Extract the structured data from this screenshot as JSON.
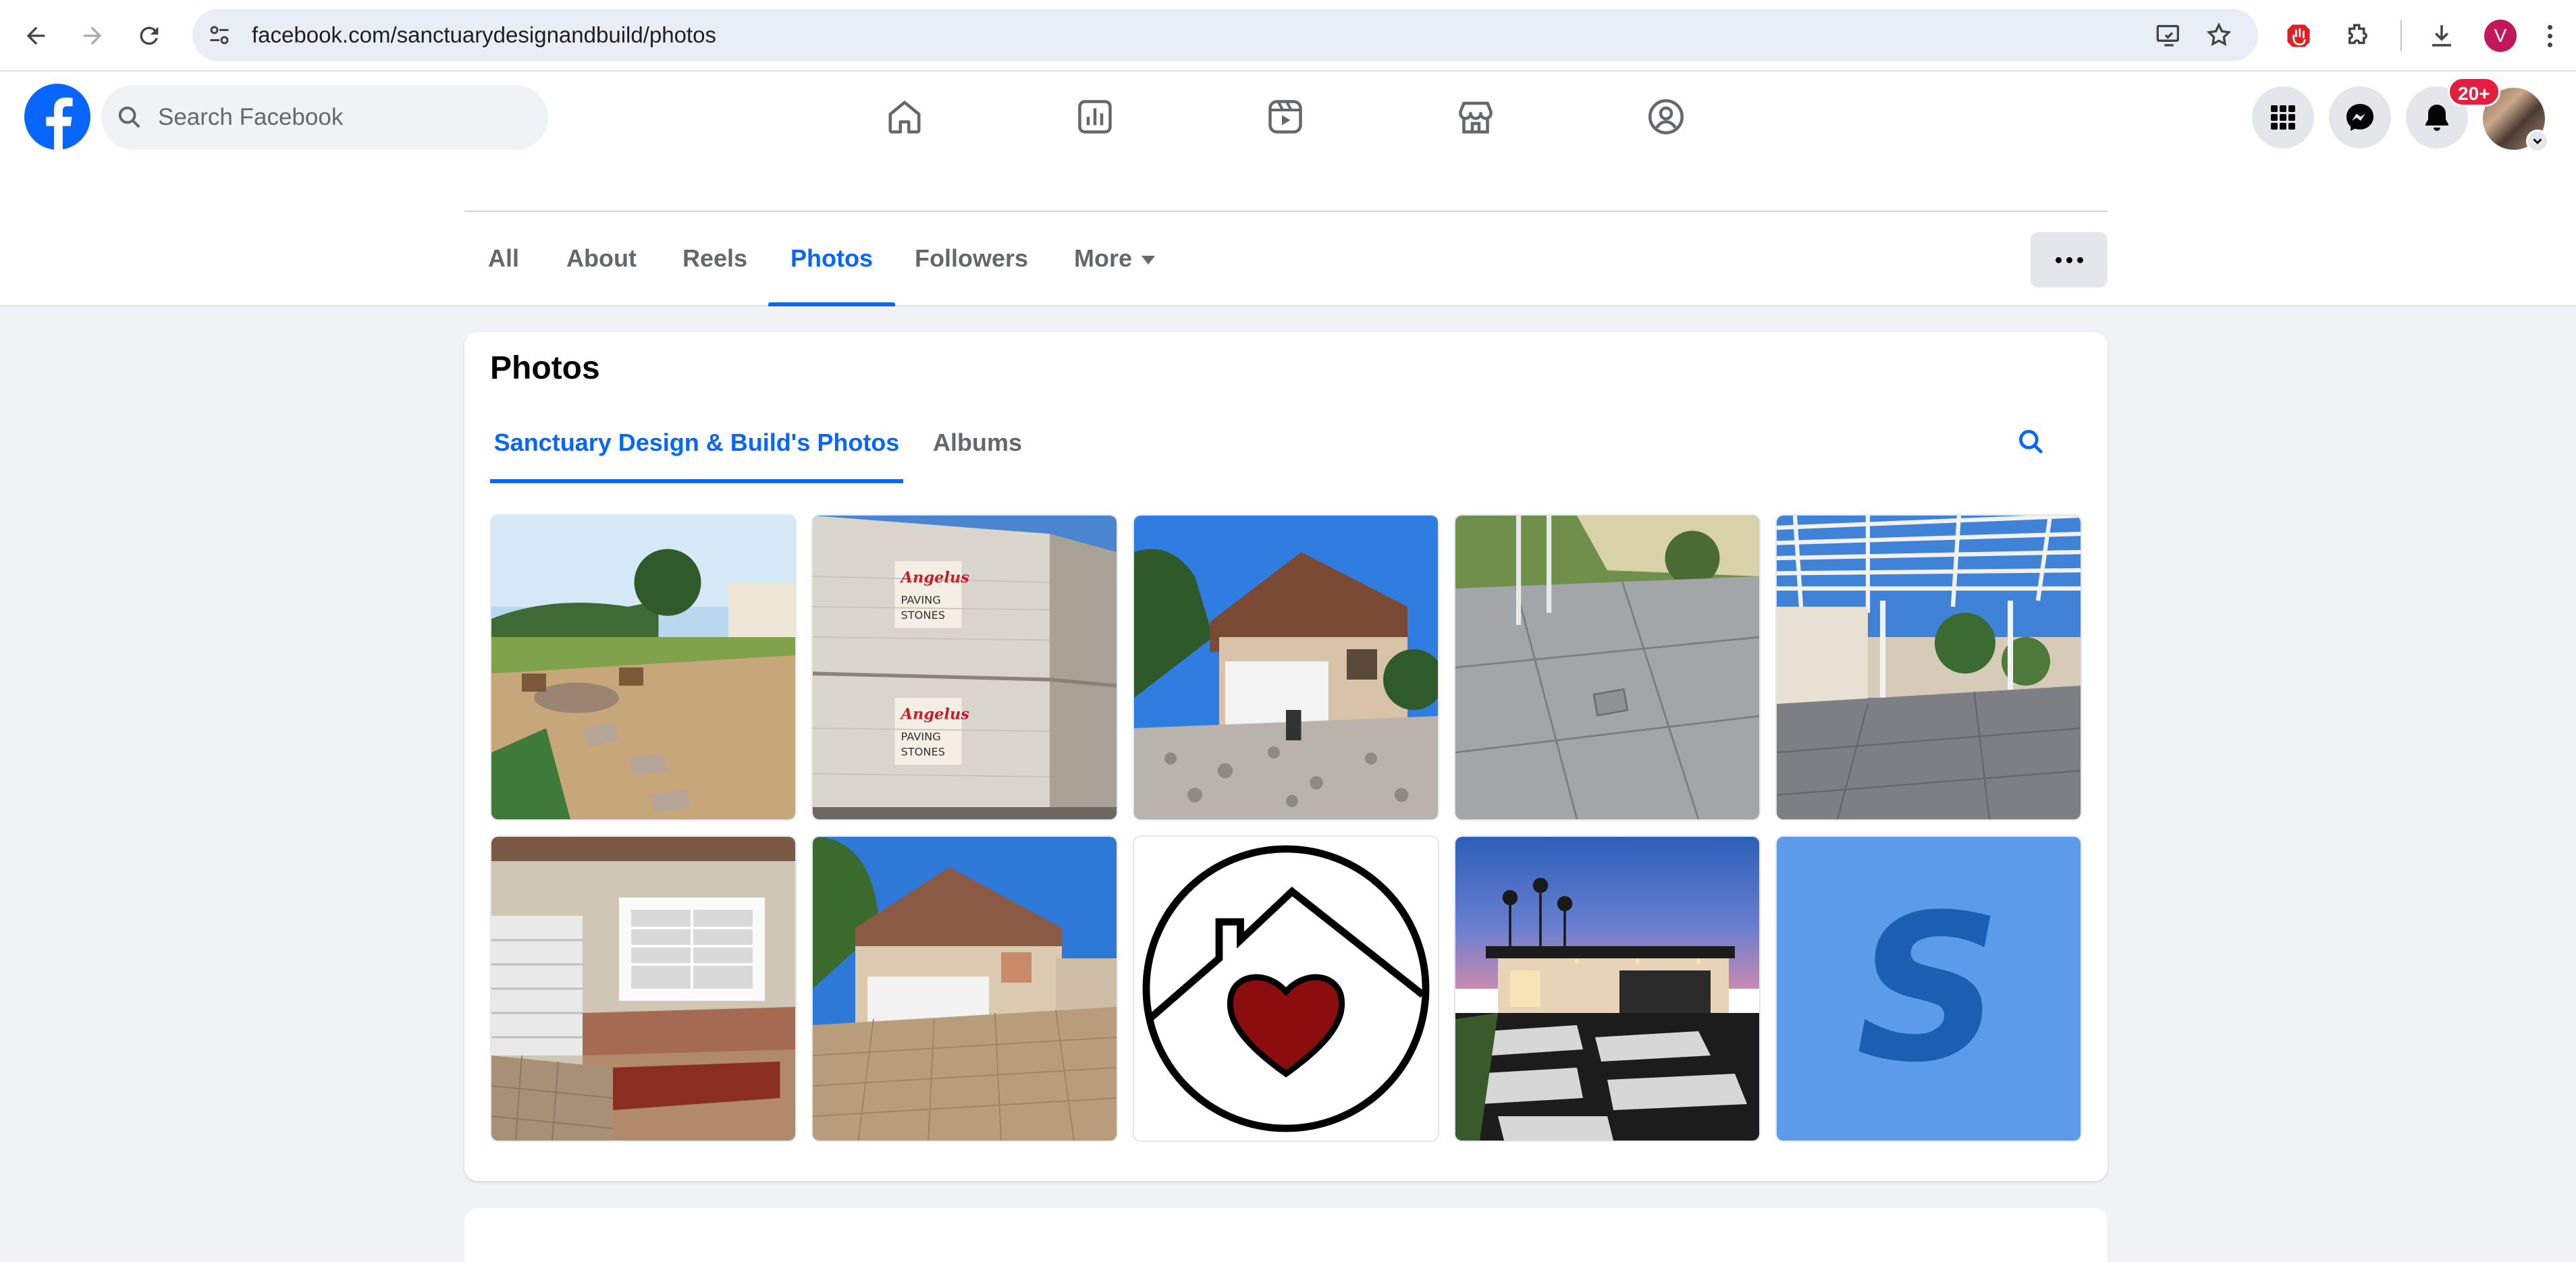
{
  "browser": {
    "url": "facebook.com/sanctuarydesignandbuild/photos",
    "profile_initial": "V"
  },
  "header": {
    "search_placeholder": "Search Facebook",
    "notification_count": "20+",
    "nav_icons": [
      "home-icon",
      "leaderboard-icon",
      "video-icon",
      "marketplace-icon",
      "groups-icon"
    ],
    "right_icons": [
      "menu-grid-icon",
      "messenger-icon",
      "notifications-icon",
      "account-avatar"
    ]
  },
  "page_tabs": {
    "items": [
      "All",
      "About",
      "Reels",
      "Photos",
      "Followers",
      "More"
    ],
    "active": "Photos"
  },
  "photos": {
    "title": "Photos",
    "sub_tabs": [
      "Sanctuary Design & Build's Photos",
      "Albums"
    ],
    "active_sub_tab": "Sanctuary Design & Build's Photos",
    "logo_tile_letter": "S",
    "tiles": [
      "backyard-patio-fire-pit",
      "angelus-paving-stones-pallets",
      "house-front-demolition",
      "concrete-patio-slabs",
      "pergola-patio",
      "house-window-paver-border",
      "house-paver-driveway",
      "company-logo-house-heart",
      "modern-house-dusk-lit",
      "logo-letter-s"
    ],
    "pallet_text": [
      "Angelus",
      "PAVING",
      "STONES"
    ]
  },
  "colors": {
    "fb_blue": "#0866ff",
    "badge_red": "#e41e3f",
    "page_bg": "#f0f2f5"
  }
}
